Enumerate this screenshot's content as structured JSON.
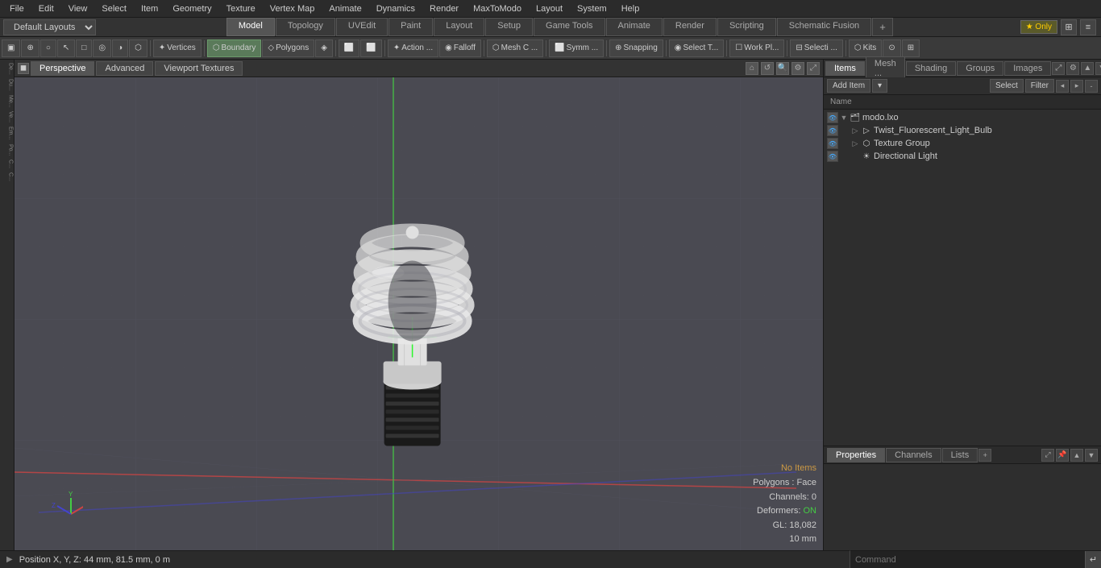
{
  "menu": {
    "items": [
      "File",
      "Edit",
      "View",
      "Select",
      "Item",
      "Geometry",
      "Texture",
      "Vertex Map",
      "Animate",
      "Dynamics",
      "Render",
      "MaxToModo",
      "Layout",
      "System",
      "Help"
    ]
  },
  "mode_bar": {
    "layout_label": "Default Layouts ▾",
    "tabs": [
      "Model",
      "Topology",
      "UVEdit",
      "Paint",
      "Layout",
      "Setup",
      "Game Tools",
      "Animate",
      "Render",
      "Scripting",
      "Schematic Fusion"
    ],
    "active_tab": "Model",
    "plus_label": "+",
    "only_label": "★ Only",
    "icon_labels": [
      "⊞",
      "≡"
    ]
  },
  "toolbar": {
    "items": [
      {
        "label": "▣",
        "name": "tb-select-box"
      },
      {
        "label": "⊕",
        "name": "tb-world"
      },
      {
        "label": "○",
        "name": "tb-circle"
      },
      {
        "label": "↖",
        "name": "tb-arrow"
      },
      {
        "label": "□",
        "name": "tb-select-rect"
      },
      {
        "label": "◎",
        "name": "tb-poly"
      },
      {
        "label": "◑",
        "name": "tb-half"
      },
      {
        "label": "⬡",
        "name": "tb-hex"
      },
      "sep",
      {
        "label": "✦ Vertices",
        "name": "tb-vertices"
      },
      "sep",
      {
        "label": "⬡ Boundary",
        "name": "tb-boundary",
        "active": true
      },
      {
        "label": "◇ Polygons",
        "name": "tb-polygons"
      },
      {
        "label": "◈",
        "name": "tb-mode4"
      },
      "sep",
      {
        "label": "⬜",
        "name": "tb-mode5"
      },
      {
        "label": "⬜",
        "name": "tb-mode6"
      },
      "sep",
      {
        "label": "✦ Action ...",
        "name": "tb-action"
      },
      {
        "label": "◉ Falloff",
        "name": "tb-falloff"
      },
      "sep",
      {
        "label": "⬡ Mesh C ...",
        "name": "tb-mesh"
      },
      "sep",
      {
        "label": "⬜ Symm ...",
        "name": "tb-symm"
      },
      "sep",
      {
        "label": "⊕ Snapping",
        "name": "tb-snapping"
      },
      "sep",
      {
        "label": "◉ Select T...",
        "name": "tb-select-t"
      },
      "sep",
      {
        "label": "☐ Work Pl...",
        "name": "tb-work-plane"
      },
      "sep",
      {
        "label": "⊟ Selecti ...",
        "name": "tb-selection"
      },
      "sep",
      {
        "label": "⬡ Kits",
        "name": "tb-kits"
      },
      {
        "label": "⊙",
        "name": "tb-icon1"
      },
      {
        "label": "⊞",
        "name": "tb-icon2"
      }
    ]
  },
  "viewport": {
    "tabs": [
      "Perspective",
      "Advanced",
      "Viewport Textures"
    ],
    "active_tab": "Perspective",
    "status": {
      "no_items": "No Items",
      "polygons": "Polygons : Face",
      "channels": "Channels: 0",
      "deformers": "Deformers: ON",
      "gl": "GL: 18,082",
      "mm": "10 mm"
    }
  },
  "left_sidebar": {
    "tools": [
      "De...",
      "Du...",
      "Me...",
      "Ve...",
      "Em...",
      "Po...",
      "C...",
      "C..."
    ]
  },
  "right_panel": {
    "tabs": [
      "Items",
      "Mesh ...",
      "Shading",
      "Groups",
      "Images"
    ],
    "active_tab": "Items",
    "toolbar": {
      "add_item_label": "Add Item",
      "add_item_arrow": "▾",
      "select_label": "Select",
      "filter_label": "Filter",
      "col_name": "Name"
    },
    "items": [
      {
        "id": "root",
        "label": "modo.lxo",
        "indent": 0,
        "visible": true,
        "icon": "🗂",
        "expanded": true,
        "type": "root"
      },
      {
        "id": "bulb",
        "label": "Twist_Fluorescent_Light_Bulb",
        "indent": 1,
        "visible": true,
        "icon": "▷",
        "type": "mesh"
      },
      {
        "id": "texgrp",
        "label": "Texture Group",
        "indent": 1,
        "visible": true,
        "icon": "⬡",
        "type": "group"
      },
      {
        "id": "light",
        "label": "Directional Light",
        "indent": 1,
        "visible": true,
        "icon": "☀",
        "type": "light"
      }
    ]
  },
  "properties_panel": {
    "tabs": [
      "Properties",
      "Channels",
      "Lists"
    ],
    "active_tab": "Properties",
    "plus_label": "+",
    "expand_label": "⤢",
    "pin_label": "📌"
  },
  "status_bar": {
    "position_label": "Position X, Y, Z:   44 mm, 81.5 mm, 0 m",
    "command_placeholder": "Command"
  },
  "colors": {
    "accent_blue": "#3a5a7a",
    "active_green": "#5a7a5a",
    "grid_line": "#555566",
    "axis_x": "#cc3333",
    "axis_y": "#33cc33",
    "axis_z": "#3333cc",
    "no_items_text": "#cc9944",
    "on_text": "#44cc44"
  }
}
